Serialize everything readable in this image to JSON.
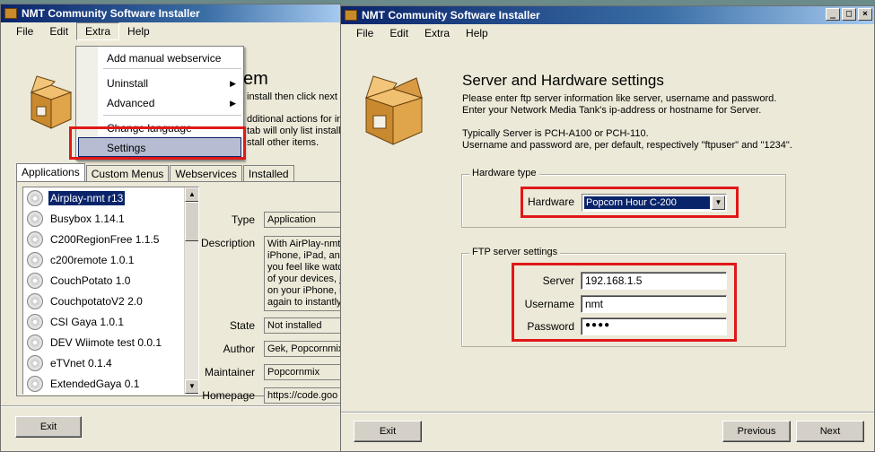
{
  "left_window": {
    "title": "NMT Community Software Installer",
    "menu": [
      "File",
      "Edit",
      "Extra",
      "Help"
    ],
    "heading_peek": "em",
    "desc_peek": [
      "install then click next t",
      "dditional actions for inst",
      "tab will only list install",
      "stall other items."
    ],
    "dropdown": {
      "items": [
        "Add manual webservice",
        "Uninstall",
        "Advanced",
        "Change language",
        "Settings"
      ],
      "submenu_marker": "▶"
    },
    "tabs": [
      "Applications",
      "Custom Menus",
      "Webservices",
      "Installed"
    ],
    "apps": [
      "Airplay-nmt r13",
      "Busybox 1.14.1",
      "C200RegionFree 1.1.5",
      "c200remote 1.0.1",
      "CouchPotato 1.0",
      "CouchpotatoV2 2.0",
      "CSI Gaya 1.0.1",
      "DEV Wiimote test 0.0.1",
      "eTVnet 0.1.4",
      "ExtendedGaya 0.1"
    ],
    "selected_app_index": 0,
    "props": {
      "type_label": "Type",
      "type_value": "Application",
      "description_label": "Description",
      "description_lines": [
        "With AirPlay-nmt",
        "iPhone, iPad, an",
        "you feel like watc",
        "of your devices, j",
        "on your iPhone, i",
        "again to instantly"
      ],
      "state_label": "State",
      "state_value": "Not installed",
      "author_label": "Author",
      "author_value": "Gek, Popcornmix",
      "maintainer_label": "Maintainer",
      "maintainer_value": "Popcornmix",
      "homepage_label": "Homepage",
      "homepage_value": "https://code.goo"
    },
    "exit_label": "Exit"
  },
  "right_window": {
    "title": "NMT Community Software Installer",
    "menu": [
      "File",
      "Edit",
      "Extra",
      "Help"
    ],
    "heading": "Server and Hardware settings",
    "intro_lines": [
      "Please enter ftp server information like server, username and password.",
      "Enter your Network Media Tank's ip-address or hostname for Server."
    ],
    "note_lines": [
      "Typically Server is PCH-A100 or PCH-110.",
      "Username and password are, per default, respectively \"ftpuser\" and \"1234\"."
    ],
    "hardware_group": {
      "legend": "Hardware type",
      "label": "Hardware",
      "value": "Popcorn Hour C-200"
    },
    "ftp_group": {
      "legend": "FTP server settings",
      "server_label": "Server",
      "server_value": "192.168.1.5",
      "username_label": "Username",
      "username_value": "nmt",
      "password_label": "Password",
      "password_value": "●●●●"
    },
    "exit_label": "Exit",
    "previous_label": "Previous",
    "next_label": "Next"
  },
  "colors": {
    "highlight": "#0a246a",
    "annotation": "#e01818",
    "window_bg": "#ece9d8"
  }
}
